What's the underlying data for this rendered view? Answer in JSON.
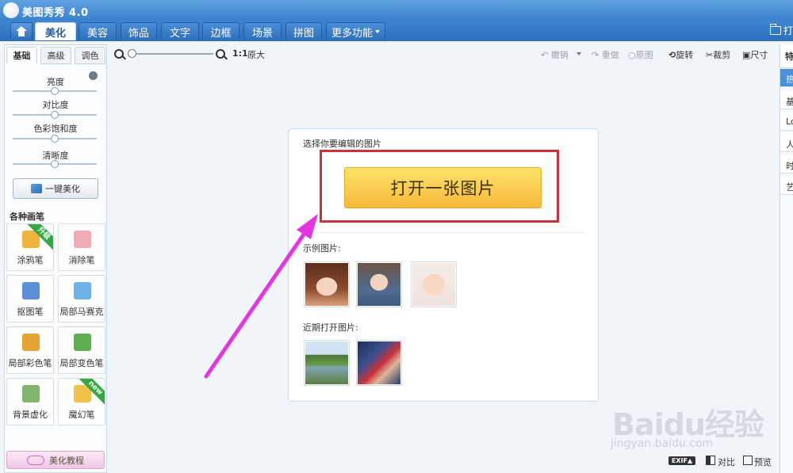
{
  "app": {
    "title": "美图秀秀 4.0"
  },
  "menu": {
    "tabs": [
      "美化",
      "美容",
      "饰品",
      "文字",
      "边框",
      "场景",
      "拼图"
    ],
    "more": "更多功能",
    "open_top": "打"
  },
  "left": {
    "tabs": [
      "基础",
      "高级",
      "调色"
    ],
    "sliders": [
      {
        "label": "亮度",
        "value": 0.5
      },
      {
        "label": "对比度",
        "value": 0.5
      },
      {
        "label": "色彩饱和度",
        "value": 0.5
      },
      {
        "label": "清晰度",
        "value": 0.5
      }
    ],
    "auto_button": "一键美化",
    "brushes_title": "各种画笔",
    "brushes": [
      {
        "label": "涂鸦笔",
        "badge": "升级",
        "color": "#f0b43c"
      },
      {
        "label": "消除笔",
        "badge": "",
        "color": "#f2aab4"
      },
      {
        "label": "抠图笔",
        "badge": "",
        "color": "#5c8fd6"
      },
      {
        "label": "局部马赛克",
        "badge": "",
        "color": "#6db3e8"
      },
      {
        "label": "局部彩色笔",
        "badge": "",
        "color": "#e6a232"
      },
      {
        "label": "局部变色笔",
        "badge": "",
        "color": "#5fae52"
      },
      {
        "label": "背景虚化",
        "badge": "",
        "color": "#7fb56c"
      },
      {
        "label": "魔幻笔",
        "badge": "new",
        "color": "#f1c24a"
      }
    ],
    "tutorial": "美化教程"
  },
  "toolbar": {
    "ratio": "1:1",
    "original_size": "原大",
    "undo": "撤销",
    "redo": "重做",
    "original": "原图",
    "rotate": "旋转",
    "crop": "裁剪",
    "size": "尺寸"
  },
  "card": {
    "select_label": "选择你要编辑的图片",
    "open_button": "打开一张图片",
    "examples_label": "示例图片:",
    "recent_label": "近期打开图片:"
  },
  "right": {
    "head": "特",
    "items": [
      "热",
      "基",
      "Lo",
      "人",
      "时",
      "艺"
    ]
  },
  "bottom": {
    "exif": "EXIF▲",
    "compare": "对比",
    "preview": "预览"
  },
  "watermark": {
    "brand": "Baidu经验",
    "url": "jingyan.baidu.com"
  }
}
